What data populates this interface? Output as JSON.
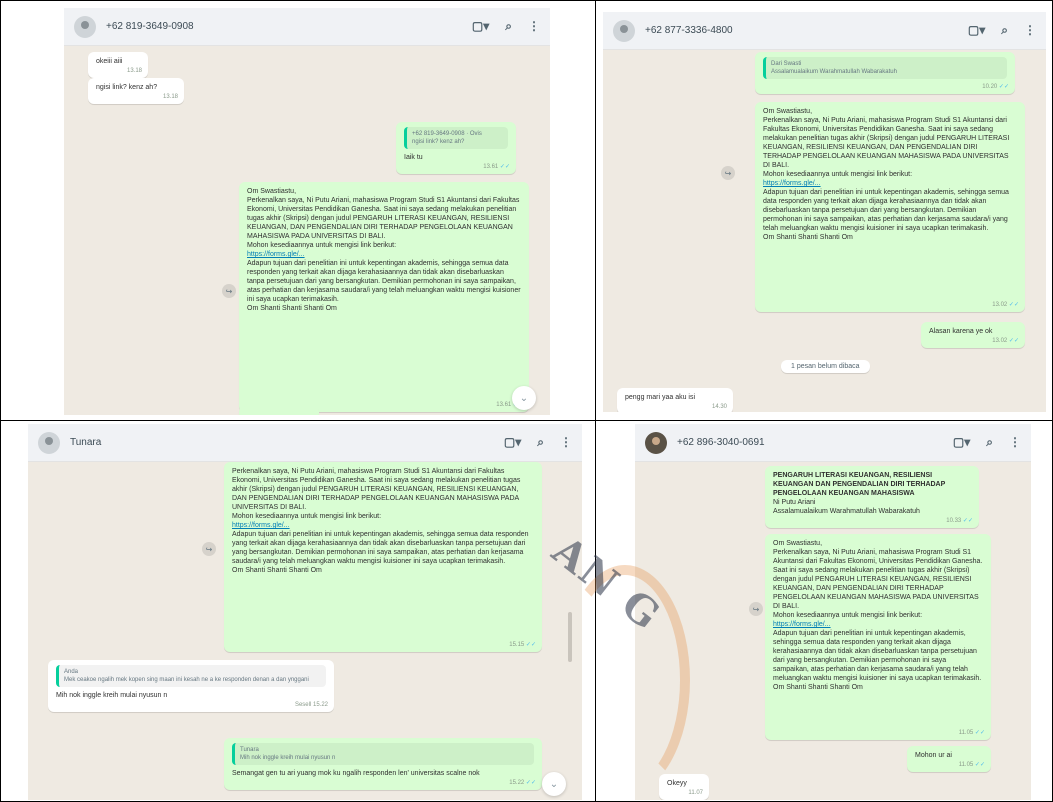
{
  "body_text": {
    "greeting": "Om Swastiastu,",
    "intro": "Perkenalkan saya, Ni Putu Ariani, mahasiswa Program Studi S1 Akuntansi dari Fakultas Ekonomi, Universitas Pendidikan Ganesha. Saat ini saya sedang melakukan penelitian tugas akhir (Skripsi) dengan judul PENGARUH LITERASI KEUANGAN, RESILIENSI KEUANGAN, DAN PENGENDALIAN DIRI TERHADAP PENGELOLAAN KEUANGAN MAHASISWA PADA UNIVERSITAS DI BALI.",
    "request": "Mohon kesediaannya untuk mengisi link berikut:",
    "link": "https://forms.gle/...",
    "purpose": "Adapun tujuan dari penelitian ini untuk kepentingan akademis, sehingga semua data responden yang terkait akan dijaga kerahasiaannya dan tidak akan disebarluaskan tanpa persetujuan dari yang bersangkutan. Demikian permohonan ini saya sampaikan, atas perhatian dan kerjasama saudara/i yang telah meluangkan waktu mengisi kuisioner ini saya ucapkan terimakasih.",
    "closing": "Om Shanti Shanti Shanti Om"
  },
  "panel1": {
    "contact": "+62 819-3649-0908",
    "msg_in_1": "okeiii aiii",
    "msg_in_1_time": "13.18",
    "msg_in_2": "ngisi link? kenz ah?",
    "msg_in_2_time": "13.18",
    "reply_quote": "+62 819-3649-0908 · Ovis",
    "reply_quote_text": "ngisi link? kenz ah?",
    "reply_text": "Iaik tu",
    "reply_time": "13.61",
    "long_time": "13.61"
  },
  "panel2": {
    "contact": "+62 877-3336-4800",
    "header_quote": "Dari Swasti",
    "header_quote_text": "Assalamualaikum Warahmatullah Wabarakatuh",
    "header_quote_time": "10.20",
    "long_time": "13.02",
    "reply": "Alasan karena ye ok",
    "reply_time": "13.02",
    "unread": "1 pesan belum dibaca",
    "incoming": "pengg mari yaa aku isi",
    "incoming_time": "14.30"
  },
  "panel3": {
    "contact": "Tunara",
    "long_time": "15.15",
    "quote_name": "Anda",
    "quote_text": "Mek ceakoe ngalih mek kopen sing maan ini kesah ne a ke responden denan a dan ynggani",
    "incoming": "Mih nok inggle kreih mulai nyusun n",
    "incoming_time": "Sesell 15.22",
    "out_quote_name": "Tunara",
    "out_quote_text": "Mih nok inggle kreih mulai nyusun n",
    "out_text": "Semangat gen tu ari yuang mok ku ngalih responden len' universitas scalne nok",
    "out_time": "15.22"
  },
  "panel4": {
    "contact": "+62 896-3040-0691",
    "header_bold": "PENGARUH LITERASI KEUANGAN, RESILIENSI KEUANGAN DAN PENGENDALIAN DIRI TERHADAP PENGELOLAAN KEUANGAN MAHASISWA",
    "header_sub": "Ni Putu Ariani",
    "header_sub2": "Assalamualaikum Warahmatullah Wabarakatuh",
    "header_time": "10.33",
    "long_time": "11.05",
    "reply": "Mohon ur ai",
    "reply_time": "11.05",
    "incoming": "Okeyy",
    "incoming_time": "11.07"
  },
  "watermark": "AN G",
  "colors": {
    "chat_bg": "#efeae2",
    "outgoing": "#d9fdd3",
    "incoming": "#ffffff",
    "header": "#f0f2f5",
    "link": "#027eb5"
  }
}
